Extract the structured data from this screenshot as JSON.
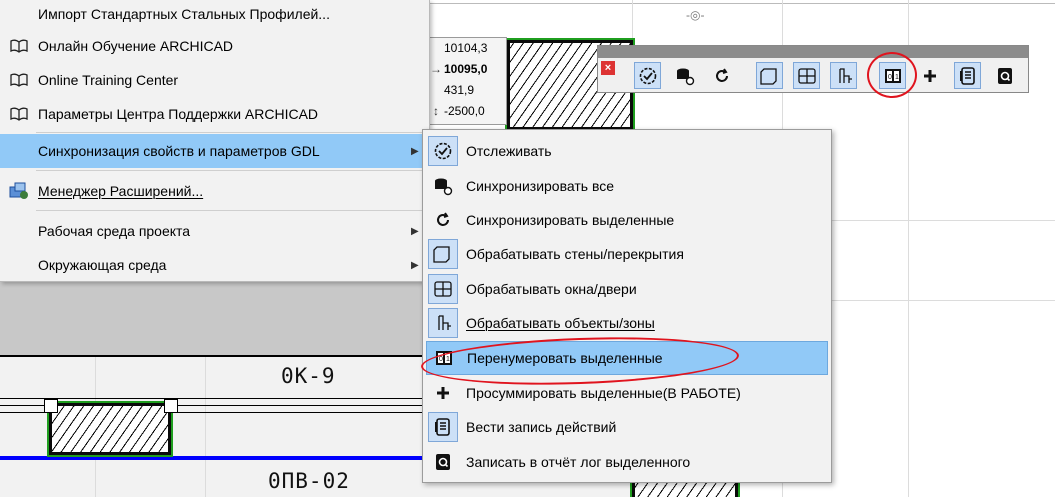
{
  "canvas": {
    "label_ok9": "0K-9",
    "label_opv02": "0ПВ-02"
  },
  "tracker": {
    "rows": [
      {
        "symbol": "",
        "value": "10104,3"
      },
      {
        "symbol": "→",
        "value": "10095,0"
      },
      {
        "symbol": "",
        "value": "431,9"
      },
      {
        "symbol": "↕",
        "value": "-2500,0"
      }
    ]
  },
  "toolbar": {
    "buttons": [
      {
        "icon": "track-icon"
      },
      {
        "icon": "sync-all-icon"
      },
      {
        "icon": "sync-selected-icon"
      },
      {
        "icon": "walls-slabs-icon"
      },
      {
        "icon": "windows-doors-icon"
      },
      {
        "icon": "objects-zones-icon"
      },
      {
        "icon": "renumber-icon"
      },
      {
        "icon": "sum-icon"
      },
      {
        "icon": "log-actions-icon"
      },
      {
        "icon": "report-log-icon"
      }
    ]
  },
  "main_menu": {
    "items": [
      {
        "label": "Импорт Стандартных Стальных Профилей...",
        "icon": ""
      },
      {
        "label": "Онлайн Обучение ARCHICAD",
        "icon": "book-icon"
      },
      {
        "label": "Online Training Center",
        "icon": "book-icon"
      },
      {
        "label": "Параметры Центра Поддержки ARCHICAD",
        "icon": "book-icon"
      },
      {
        "label": "Синхронизация свойств и параметров GDL",
        "icon": "",
        "submenu": true
      },
      {
        "label": "Менеджер Расширений...",
        "icon": "extension-manager-icon"
      },
      {
        "label": "Рабочая среда проекта",
        "icon": "",
        "submenu": true
      },
      {
        "label": "Окружающая среда",
        "icon": "",
        "submenu": true
      }
    ]
  },
  "sub_menu": {
    "items": [
      {
        "label": "Отслеживать"
      },
      {
        "label": "Синхронизировать все"
      },
      {
        "label": "Синхронизировать выделенные"
      },
      {
        "label": "Обрабатывать стены/перекрытия"
      },
      {
        "label": "Обрабатывать окна/двери"
      },
      {
        "label": "Обрабатывать объекты/зоны"
      },
      {
        "label": "Перенумеровать выделенные"
      },
      {
        "label": "Просуммировать выделенные(В РАБОТЕ)"
      },
      {
        "label": "Вести запись действий"
      },
      {
        "label": "Записать в отчёт лог выделенного"
      }
    ]
  },
  "colors": {
    "highlight": "#91c9f7",
    "annotation": "#e0141e",
    "wall_blue": "#0000ff"
  }
}
